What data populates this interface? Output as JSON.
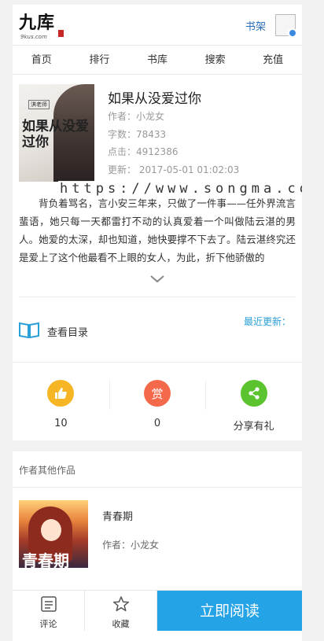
{
  "header": {
    "logo_text": "九库",
    "logo_sub": "9kus.com",
    "shelf_label": "书架"
  },
  "nav": [
    "首页",
    "排行",
    "书库",
    "搜索",
    "充值"
  ],
  "book": {
    "cover_author": "淇老师",
    "cover_title": "如果从没爱过你",
    "title": "如果从没爱过你",
    "author_label": "作者：",
    "author": "小龙女",
    "words_label": "字数：",
    "words": "78433",
    "clicks_label": "点击：",
    "clicks": "4912386",
    "updated_label": "更新：",
    "updated": "2017-05-01 01:02:03"
  },
  "watermark": "https://www.songma.co",
  "synopsis": "背负着骂名，言小安三年来，只做了一件事——任外界流言蜚语，她只每一天都雷打不动的认真爱着一个叫做陆云湛的男人。她爱的太深，却也知道，她快要撑不下去了。陆云湛终究还是爱上了这个他最看不上眼的女人，为此，折下他骄傲的",
  "catalog": {
    "label": "查看目录",
    "latest_label": "最近更新："
  },
  "actions": [
    {
      "name": "like",
      "icon": "thumbs-up-icon",
      "color": "#f5b524",
      "value": "10"
    },
    {
      "name": "reward",
      "icon": "reward-icon",
      "glyph": "赏",
      "color": "#f4694a",
      "value": "0"
    },
    {
      "name": "share",
      "icon": "share-icon",
      "color": "#5ac32e",
      "value": "分享有礼"
    }
  ],
  "other_works": {
    "heading": "作者其他作品",
    "items": [
      {
        "title": "青春期",
        "author": "作者：小龙女",
        "cover_text": "青春期"
      }
    ]
  },
  "bottom": {
    "comment_label": "评论",
    "favorite_label": "收藏",
    "read_label": "立即阅读"
  }
}
